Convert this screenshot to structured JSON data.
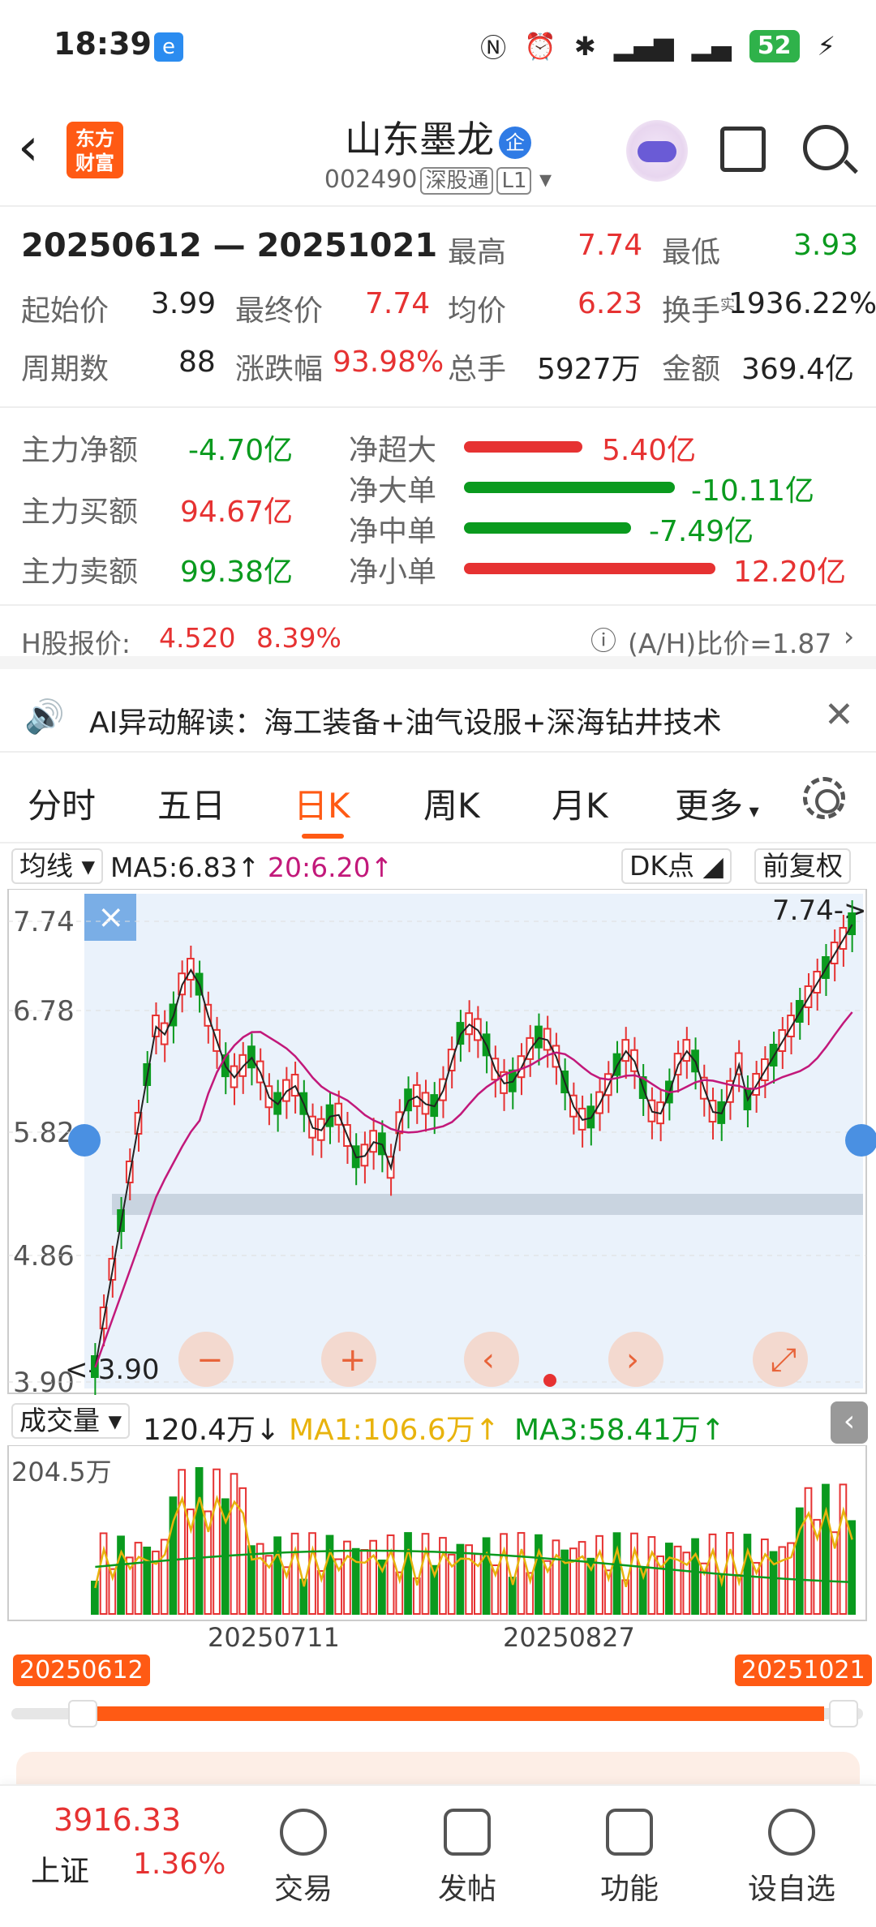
{
  "status": {
    "time": "18:39",
    "battery": "52"
  },
  "header": {
    "logo": "东方财富",
    "stock_name": "山东墨龙",
    "qi_badge": "企",
    "code": "002490",
    "tag1": "深股通",
    "tag2": "L1"
  },
  "stats": {
    "range": "20250612 — 20251021",
    "high_label": "最高",
    "high": "7.74",
    "low_label": "最低",
    "low": "3.93",
    "start_label": "起始价",
    "start": "3.99",
    "end_label": "最终价",
    "end": "7.74",
    "avg_label": "均价",
    "avg": "6.23",
    "turn_label": "换手",
    "turn_sup": "实",
    "turn": "1936.22%",
    "days_label": "周期数",
    "days": "88",
    "chg_label": "涨跌幅",
    "chg": "93.98%",
    "vol_label": "总手",
    "vol": "5927万",
    "amt_label": "金额",
    "amt": "369.4亿"
  },
  "flow": {
    "net_label": "主力净额",
    "net": "-4.70亿",
    "buy_label": "主力买额",
    "buy": "94.67亿",
    "sell_label": "主力卖额",
    "sell": "99.38亿",
    "bars": [
      {
        "label": "净超大",
        "value": "5.40亿",
        "color": "#e63232"
      },
      {
        "label": "净大单",
        "value": "-10.11亿",
        "color": "#0a9a1e"
      },
      {
        "label": "净中单",
        "value": "-7.49亿",
        "color": "#0a9a1e"
      },
      {
        "label": "净小单",
        "value": "12.20亿",
        "color": "#e63232"
      }
    ]
  },
  "hshare": {
    "label": "H股报价:",
    "price": "4.520",
    "pct": "8.39%",
    "ratio": "(A/H)比价=1.87"
  },
  "ai": {
    "text": "AI异动解读：海工装备+油气设服+深海钻井技术"
  },
  "tabs": [
    "分时",
    "五日",
    "日K",
    "周K",
    "月K",
    "更多"
  ],
  "ma": {
    "selector": "均线",
    "ma5": "MA5:6.83",
    "ma20": "20:6.20",
    "dk": "DK点",
    "fq": "前复权"
  },
  "chart": {
    "y_labels": [
      "7.74",
      "6.78",
      "5.82",
      "4.86",
      "3.90"
    ],
    "max_tag": "7.74->",
    "min_tag": "<-3.90"
  },
  "volume": {
    "selector": "成交量",
    "current": "120.4万",
    "ma1": "MA1:106.6万",
    "ma3": "MA3:58.41万",
    "ymax": "204.5万",
    "dates": [
      "20250711",
      "20250827"
    ],
    "start": "20250612",
    "end": "20251021"
  },
  "bottom": {
    "index_value": "3916.33",
    "index_name": "上证",
    "index_pct": "1.36%",
    "items": [
      "交易",
      "发帖",
      "功能",
      "设自选"
    ]
  },
  "colors": {
    "up": "#e63232",
    "down": "#0a9a1e",
    "accent": "#ff5a14"
  }
}
